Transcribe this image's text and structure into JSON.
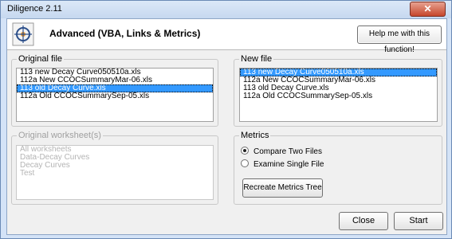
{
  "window": {
    "title": "Diligence 2.11",
    "close_glyph": "✕"
  },
  "header": {
    "heading": "Advanced (VBA, Links & Metrics)",
    "help_label": "Help me with this function!"
  },
  "original_file": {
    "label": "Original file",
    "items": [
      "113 new Decay Curve050510a.xls",
      "112a New CCOCSummaryMar-06.xls",
      "113 old Decay Curve.xls",
      "112a Old CCOCSummarySep-05.xls"
    ],
    "selected_index": 2
  },
  "new_file": {
    "label": "New file",
    "items": [
      "113 new Decay Curve050510a.xls",
      "112a New CCOCSummaryMar-06.xls",
      "113 old Decay Curve.xls",
      "112a Old CCOCSummarySep-05.xls"
    ],
    "selected_index": 0
  },
  "original_worksheets": {
    "label": "Original worksheet(s)",
    "items": [
      "All worksheets",
      "Data-Decay Curves",
      "Decay Curves",
      "Test"
    ]
  },
  "metrics": {
    "label": "Metrics",
    "compare_label": "Compare Two Files",
    "examine_label": "Examine Single File",
    "selected": "compare",
    "recreate_label": "Recreate Metrics Tree"
  },
  "footer": {
    "close_label": "Close",
    "start_label": "Start"
  }
}
